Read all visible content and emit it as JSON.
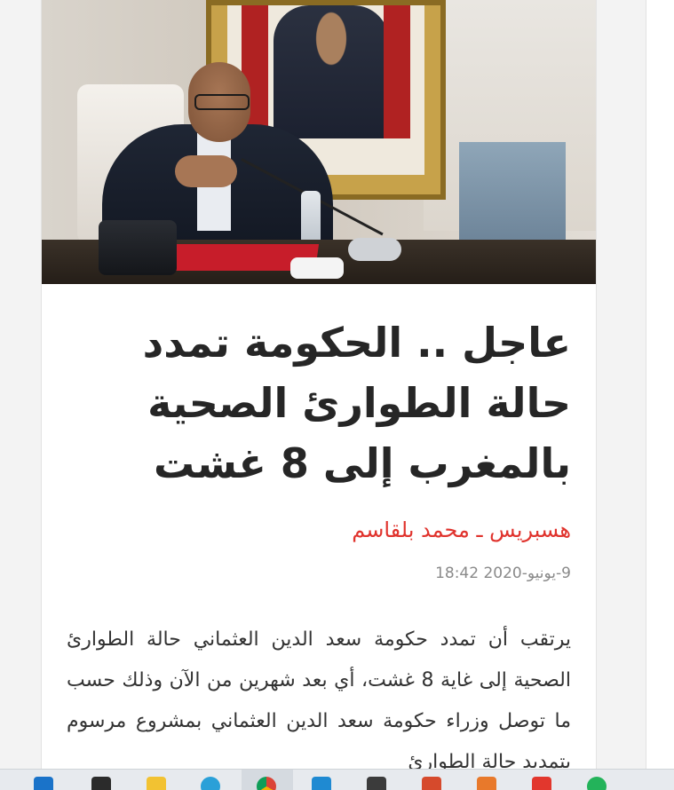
{
  "article": {
    "title": "عاجل .. الحكومة تمدد حالة الطوارئ الصحية بالمغرب إلى 8 غشت",
    "byline": "هسبريس ـ محمد بلقاسم",
    "date": "9-يونيو-2020 18:42",
    "body": "يرتقب أن تمدد حكومة سعد الدين العثماني حالة الطوارئ الصحية إلى غاية 8 غشت، أي بعد شهرين من الآن وذلك حسب ما توصل وزراء حكومة سعد الدين العثماني بمشروع مرسوم بتمديد حالة الطوارئ"
  },
  "taskbar": {
    "icons": [
      "mail-icon",
      "store-icon",
      "file-explorer-icon",
      "edge-icon",
      "chrome-icon",
      "vscode-icon",
      "inkscape-icon",
      "office-icon",
      "app-orange-icon",
      "app-red-icon",
      "app-green-icon"
    ]
  },
  "colors": {
    "accent": "#e0332d",
    "title": "#262626",
    "date": "#8a8a8a"
  }
}
